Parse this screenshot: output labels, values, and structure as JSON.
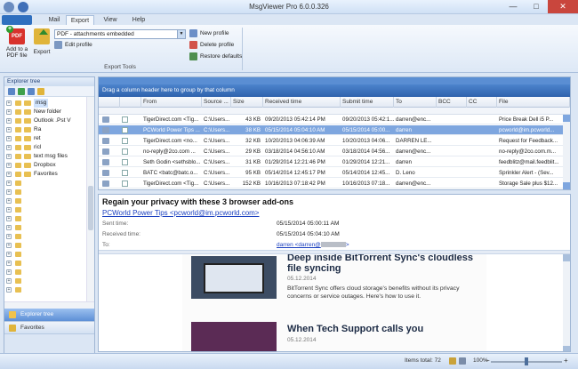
{
  "window": {
    "title": "MsgViewer Pro 6.0.0.326",
    "min_label": "—",
    "max_label": "□",
    "close_label": "✕"
  },
  "tabs": [
    {
      "label": "Mail",
      "active": false
    },
    {
      "label": "Export",
      "active": true
    },
    {
      "label": "View",
      "active": false
    },
    {
      "label": "Help",
      "active": false
    }
  ],
  "ribbon": {
    "add_pdf_label_1": "Add to a",
    "add_pdf_label_2": "PDF file",
    "pdf_icon_text": "PDF",
    "export_label": "Export",
    "profile_value": "PDF - attachments embedded",
    "edit_profile": "Edit profile",
    "new_profile": "New profile",
    "delete_profile": "Delete profile",
    "restore_defaults": "Restore defaults",
    "group_label": "Export Tools"
  },
  "explorer": {
    "title": "Explorer tree",
    "tree": [
      {
        "label": "msg",
        "selected": true
      },
      {
        "label": "New folder",
        "selected": false
      },
      {
        "label": "Outlook .Pst V",
        "selected": false
      },
      {
        "label": "Ra",
        "selected": false
      },
      {
        "label": "ret",
        "selected": false
      },
      {
        "label": "ricl",
        "selected": false
      },
      {
        "label": "text msg files",
        "selected": false
      },
      {
        "label": "Dropbox",
        "selected": false
      },
      {
        "label": "Favorites",
        "selected": false
      },
      {
        "label": "",
        "selected": false
      },
      {
        "label": "",
        "selected": false
      },
      {
        "label": "",
        "selected": false
      },
      {
        "label": "",
        "selected": false
      },
      {
        "label": "",
        "selected": false
      },
      {
        "label": "",
        "selected": false
      },
      {
        "label": "",
        "selected": false
      },
      {
        "label": "",
        "selected": false
      },
      {
        "label": "",
        "selected": false
      },
      {
        "label": "",
        "selected": false
      },
      {
        "label": "",
        "selected": false
      },
      {
        "label": "",
        "selected": false
      },
      {
        "label": "",
        "selected": false
      }
    ],
    "nav_explorer": "Explorer tree",
    "nav_favorites": "Favorites"
  },
  "grid": {
    "group_hint": "Drag a column header here to group by that column",
    "columns": [
      "From",
      "Source ...",
      "Size",
      "Received time",
      "Submit time",
      "To",
      "BCC",
      "CC",
      "File"
    ],
    "rows": [
      {
        "from": "TigerDirect.com <Tig...",
        "source": "C:\\Users...",
        "size": "43 KB",
        "received": "09/20/2013 05:42:14 PM",
        "submit": "09/20/2013 05:42:1...",
        "to": "darren@enc...",
        "bcc": "",
        "cc": "",
        "file": "Price Break  Dell i5 P...",
        "selected": false
      },
      {
        "from": "PCWorld Power Tips ...",
        "source": "C:\\Users...",
        "size": "38 KB",
        "received": "05/15/2014 05:04:10 AM",
        "submit": "05/15/2014 05:00...",
        "to": "darren",
        "bcc": "",
        "cc": "",
        "file": "pcworld@im.pcworld...",
        "selected": true
      },
      {
        "from": "TigerDirect.com <no...",
        "source": "C:\\Users...",
        "size": "32 KB",
        "received": "10/20/2013 04:06:39 AM",
        "submit": "10/20/2013 04:06...",
        "to": "DARREN LE...",
        "bcc": "",
        "cc": "",
        "file": "Request for Feedback...",
        "selected": false
      },
      {
        "from": "no-reply@2co.com ...",
        "source": "C:\\Users...",
        "size": "29 KB",
        "received": "03/18/2014 04:56:10 AM",
        "submit": "03/18/2014 04:56...",
        "to": "darren@enc...",
        "bcc": "",
        "cc": "",
        "file": "no-reply@2co.com.m...",
        "selected": false
      },
      {
        "from": "Seth Godin <sethsblo...",
        "source": "C:\\Users...",
        "size": "31 KB",
        "received": "01/29/2014 12:21:46 PM",
        "submit": "01/29/2014 12:21...",
        "to": "darren",
        "bcc": "",
        "cc": "",
        "file": "feedblitz@mail.feedblit...",
        "selected": false
      },
      {
        "from": "BATC <batc@batc.o...",
        "source": "C:\\Users...",
        "size": "95 KB",
        "received": "05/14/2014 12:45:17 PM",
        "submit": "05/14/2014 12:45...",
        "to": "D. Leno",
        "bcc": "",
        "cc": "",
        "file": "Sprinkler Alert - (Sev...",
        "selected": false
      },
      {
        "from": "TigerDirect.com <Tig...",
        "source": "C:\\Users...",
        "size": "152 KB",
        "received": "10/16/2013 07:18:42 PM",
        "submit": "10/16/2013 07:18...",
        "to": "darren@enc...",
        "bcc": "",
        "cc": "",
        "file": "Storage Sale  plus $12...",
        "selected": false
      }
    ]
  },
  "preview": {
    "subject": "Regain your privacy with these 3 browser add-ons",
    "from": "PCWorld Power Tips <pcworld@im.pcworld.com>",
    "sent_label": "Sent time:",
    "sent_value": "05/15/2014 05:00:11 AM",
    "received_label": "Received time:",
    "received_value": "05/15/2014 05:04:10 AM",
    "to_label": "To:",
    "to_value": "darren <darren@",
    "articles": [
      {
        "title": "Deep inside BitTorrent Sync's cloudless file syncing",
        "date": "05.12.2014",
        "desc": "BitTorrent Sync offers cloud storage's benefits without its privacy concerns or service outages. Here's how to use it."
      },
      {
        "title": "When Tech Support calls you",
        "date": "05.12.2014",
        "desc": ""
      }
    ]
  },
  "status": {
    "items_total": "Items total: 72",
    "zoom": "100%"
  },
  "colors": {
    "selection": "#7ea6df",
    "header_blue": "#2f63ad",
    "close_red": "#c9463d"
  }
}
